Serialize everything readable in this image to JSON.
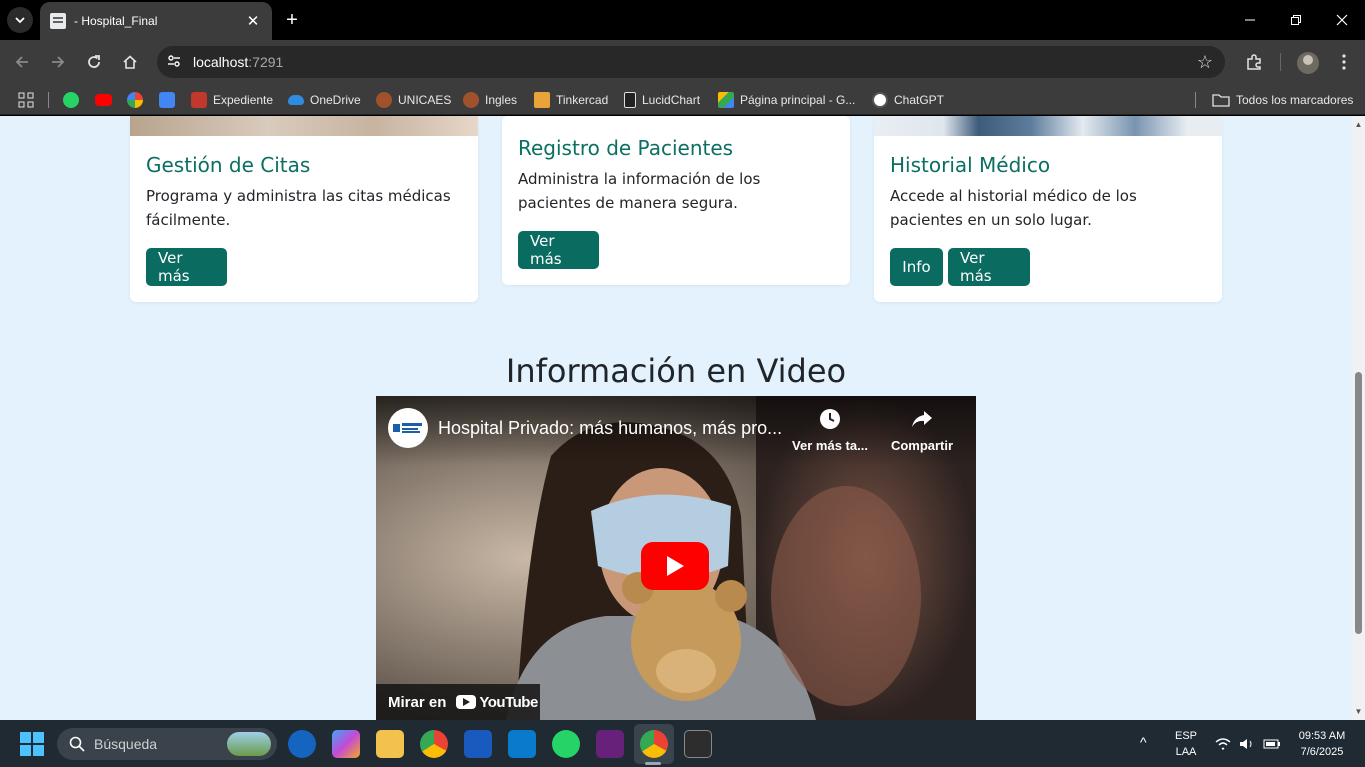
{
  "browser": {
    "tab_title": "- Hospital_Final",
    "url_host": "localhost",
    "url_port": ":7291"
  },
  "bookmarks": [
    {
      "label": "Expediente",
      "color": "#c0392b"
    },
    {
      "label": "OneDrive",
      "color": "#2e8de0"
    },
    {
      "label": "UNICAES",
      "color": "#a0522d"
    },
    {
      "label": "Ingles",
      "color": "#a0522d"
    },
    {
      "label": "Tinkercad",
      "color": "#e8a33a"
    },
    {
      "label": "LucidChart",
      "color": "#ffffff"
    },
    {
      "label": "Página principal - G...",
      "color": "#34a853"
    },
    {
      "label": "ChatGPT",
      "color": "#ffffff"
    }
  ],
  "bookmarks_all": "Todos los marcadores",
  "cards": [
    {
      "title": "Gestión de Citas",
      "text": "Programa y administra las citas médicas fácilmente.",
      "button": "Ver más"
    },
    {
      "title": "Registro de Pacientes",
      "text": "Administra la información de los pacientes de manera segura.",
      "button": "Ver más"
    },
    {
      "title": "Historial Médico",
      "text": "Accede al historial médico de los pacientes en un solo lugar.",
      "button_info": "Info",
      "button": "Ver más"
    }
  ],
  "section_title": "Información en Video",
  "video": {
    "title": "Hospital Privado: más humanos, más pro...",
    "watch_later": "Ver más ta...",
    "share": "Compartir",
    "watch_on": "Mirar en",
    "youtube": "YouTube"
  },
  "taskbar": {
    "search_placeholder": "Búsqueda",
    "lang_top": "ESP",
    "lang_bottom": "LAA",
    "time": "09:53 AM",
    "date": "7/6/2025"
  },
  "colors": {
    "accent": "#0a6b61",
    "page_bg": "#e3f2fc",
    "title_color": "#0b6f62"
  }
}
